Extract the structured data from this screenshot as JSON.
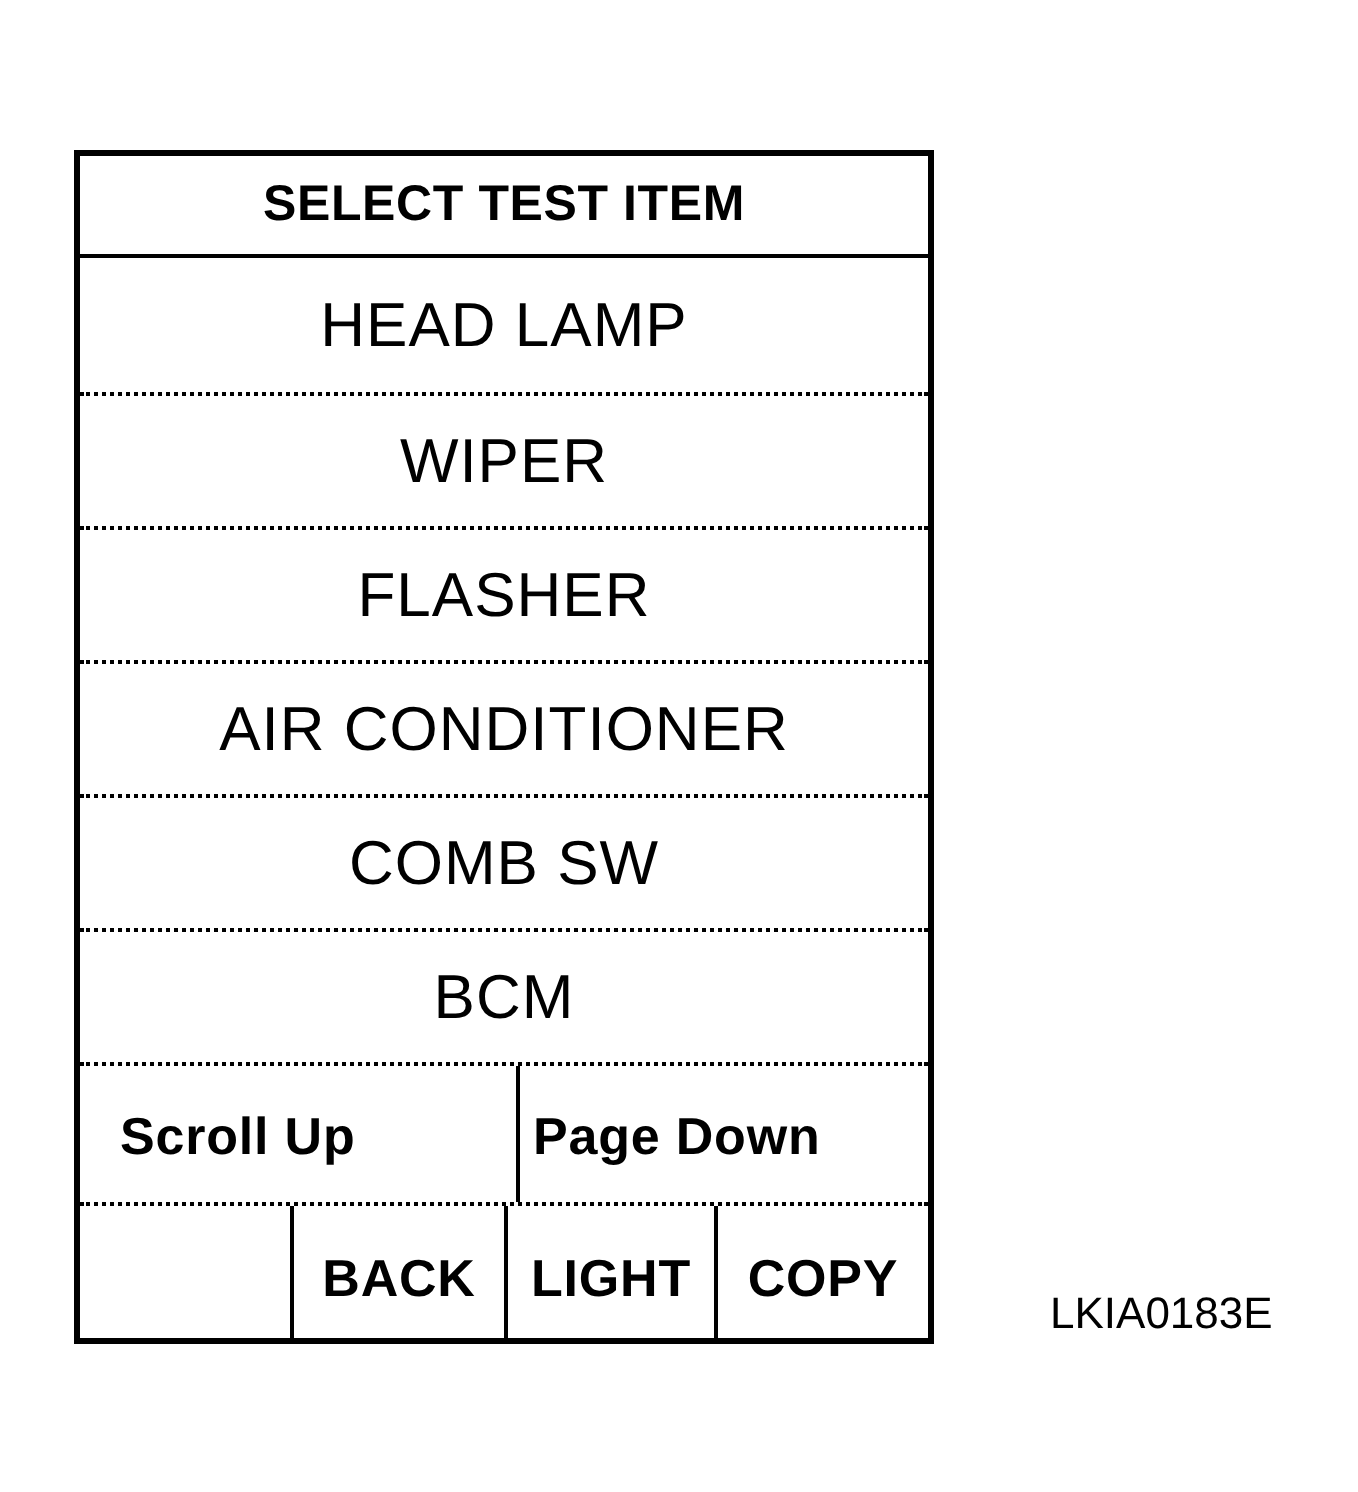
{
  "screen": {
    "title": "SELECT TEST ITEM",
    "items": [
      {
        "label": "HEAD LAMP"
      },
      {
        "label": "WIPER"
      },
      {
        "label": "FLASHER"
      },
      {
        "label": "AIR CONDITIONER"
      },
      {
        "label": "COMB SW"
      },
      {
        "label": "BCM"
      }
    ],
    "nav_buttons": [
      {
        "label": "Scroll Up"
      },
      {
        "label": "Page Down"
      }
    ],
    "buttons": [
      {
        "label": "BACK"
      },
      {
        "label": "LIGHT"
      },
      {
        "label": "COPY"
      }
    ]
  },
  "figure_code": "LKIA0183E"
}
